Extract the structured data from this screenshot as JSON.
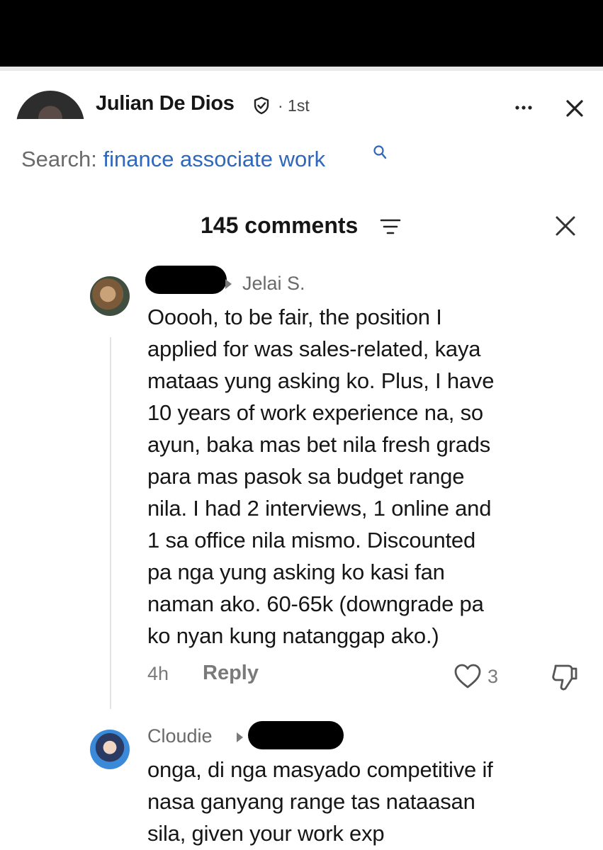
{
  "header": {
    "author_name": "Julian De Dios",
    "degree": "· 1st"
  },
  "search": {
    "label": "Search:",
    "term": "finance associate work"
  },
  "comments_sheet": {
    "title": "145 comments"
  },
  "comments": [
    {
      "reply_to": "Jelai S.",
      "body": "Ooooh, to be fair, the position I\napplied for was sales-related, kaya\nmataas yung asking ko. Plus, I have\n10 years of work experience na, so\nayun, baka mas bet nila fresh grads\npara mas pasok sa budget range\nnila. I had 2 interviews, 1 online and\n1 sa office nila mismo. Discounted\npa nga yung asking ko kasi fan\nnaman ako. 60-65k (downgrade pa\nko nyan kung natanggap ako.)",
      "time": "4h",
      "reply_label": "Reply",
      "likes": "3"
    },
    {
      "author": "Cloudie",
      "body": "onga, di nga masyado competitive if\nnasa ganyang range tas nataasan\nsila, given your work exp"
    }
  ],
  "icons": {
    "verify": "shield-check-icon",
    "more": "ellipsis-icon",
    "close": "close-icon",
    "search": "search-icon",
    "filter": "filter-icon",
    "like": "heart-icon",
    "dislike": "thumbs-down-icon"
  },
  "colors": {
    "link_blue": "#2f67bd",
    "muted_text": "#6a6a6a",
    "top_bar": "#000000"
  }
}
